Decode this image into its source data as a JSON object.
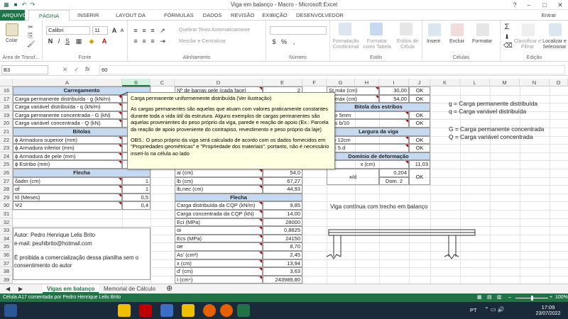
{
  "app": {
    "title": "Viga em balanço - Macro - Microsoft Excel",
    "signin": "Entrar"
  },
  "tabs": [
    "ARQUIVO",
    "PÁGINA INICIAL",
    "INSERIR",
    "LAYOUT DA PÁGINA",
    "FÓRMULAS",
    "DADOS",
    "REVISÃO",
    "EXIBIÇÃO",
    "DESENVOLVEDOR"
  ],
  "ribbon": {
    "paste": "Colar",
    "clipboard": "Área de Transf...",
    "font_name": "Calibri",
    "font_size": "11",
    "font": "Fonte",
    "wrap": "Quebrar Texto Automaticamente",
    "merge": "Mesclar e Centralizar",
    "alignment": "Alinhamento",
    "number": "Número",
    "cond_format": "Formatação Condicional",
    "table_format": "Formatar como Tabela",
    "cell_styles": "Estilos de Célula",
    "styles": "Estilo",
    "insert": "Inserir",
    "delete": "Excluir",
    "format": "Formatar",
    "cells": "Células",
    "sort": "Classificar e Filtrar",
    "find": "Localizar e Selecionar",
    "editing": "Edição"
  },
  "formula": {
    "namebox": "B3",
    "fx": "fx",
    "value": "60"
  },
  "columns": [
    "A",
    "B",
    "C",
    "D",
    "E",
    "F",
    "G",
    "H",
    "I",
    "J",
    "K",
    "L",
    "M",
    "N",
    "O"
  ],
  "rows": [
    "16",
    "17",
    "18",
    "19",
    "20",
    "21",
    "22",
    "23",
    "24",
    "25",
    "26",
    "27",
    "28",
    "29",
    "30",
    "31",
    "32",
    "33",
    "34",
    "35",
    "36",
    "37",
    "38",
    "39",
    "40"
  ],
  "left": {
    "carregamento": "Carregamento",
    "items": [
      "Carga permanente distribuída - g (kN/m)",
      "Carga variável distribuída - q (kN/m)",
      "Carga permanente concentrada - G (kN)",
      "Carga variável concentrada - Q (kN)"
    ],
    "bitolas": "Bitolas",
    "bitola_items": [
      "ϕ Armadura superior (mm)",
      "ϕ Armadura inferior (mm)",
      "ϕ Armadura de pele (mm)",
      "ϕ Estribo (mm)"
    ],
    "flecha": "Flecha",
    "flecha_items": [
      {
        "label": "δadm (cm)",
        "value": "1"
      },
      {
        "label": "αf",
        "value": "1"
      },
      {
        "label": "t0 (Meses)",
        "value": "0,5"
      },
      {
        "label": "Ψ2",
        "value": "0,4"
      }
    ],
    "author": "Autor: Pedro Henrique Lelis Brito",
    "email": "e-mail: peuhlbrito@hotmail.com",
    "notice": "É proibida a comercialização dessa planilha sem o consentimento do autor"
  },
  "middle": {
    "top_rows": [
      {
        "label": "Nº de barras pele (cada face)",
        "value": "2"
      }
    ],
    "rows": [
      {
        "label": "ai (cm)",
        "value": "54,0"
      },
      {
        "label": "lb (cm)",
        "value": "67,27"
      },
      {
        "label": "lb,nec (cm)",
        "value": "44,93"
      }
    ],
    "flecha": "Flecha",
    "flecha_rows": [
      {
        "label": "Carga distribuída da CQP (kN/m)",
        "value": "9,85"
      },
      {
        "label": "Carga concentrada da CQP (kN)",
        "value": "14,00"
      },
      {
        "label": "Eci (MPa)",
        "value": "28000"
      },
      {
        "label": "αi",
        "value": "0,8625"
      },
      {
        "label": "Ecs (MPa)",
        "value": "24150"
      },
      {
        "label": "αe",
        "value": "8,70"
      },
      {
        "label": "As' (cm²)",
        "value": "2,45"
      },
      {
        "label": "x (cm)",
        "value": "13,94"
      },
      {
        "label": "d' (cm)",
        "value": "3,63"
      },
      {
        "label": "I (cm⁴)",
        "value": "243989,80"
      }
    ]
  },
  "right": {
    "smax_rows": [
      {
        "label": "St,máx (cm)",
        "value": "30,00",
        "status": "OK"
      },
      {
        "label": "Sl,máx (cm)",
        "value": "54,00",
        "status": "OK"
      }
    ],
    "bitola_estribos": "Bitola dos estribos",
    "bitola_rows": [
      {
        "label": "ϕt ≥ 5mm",
        "status": "OK"
      },
      {
        "label": "ϕt ≤ b/10",
        "status": "OK"
      }
    ],
    "largura": "Largura da viga",
    "largura_rows": [
      {
        "label": "b ≥ 12cm",
        "status": "OK"
      },
      {
        "label": "b < 5.d",
        "status": "OK"
      }
    ],
    "dominio": "Domínio de deformação",
    "x_row": {
      "label": "x (cm)",
      "value": "11,03"
    },
    "xd": {
      "label": "x/d",
      "value": "0,204",
      "domain": "Dom. 2",
      "status": "OK"
    },
    "legend": [
      "g = Carga permanente distribuída",
      "q = Carga variável distribuída",
      "G = Carga permanente concentrada",
      "Q = Carga variável concentrada"
    ],
    "diagram_label": "Viga contínua com trecho em balanço"
  },
  "comment": {
    "title": "Carga permanente uniformemente distribuída (Ver ilustração)",
    "p1": "As cargas permanentes são aquelas que atuam com valores praticamente constantes durante toda a vida útil da estrutura. Alguns exemplos de cargas permanentes são aquelas provenientes do peso próprio da viga, parede e reação de apoio (Ex.: Parcela da reação de apoio proveniente do contrapiso, revestimento e peso próprio da laje)",
    "p2": "OBS.: O peso próprio da viga será calculado de acordo com os dados fornecidos em \"Propriedades geométricas\" e \"Propriedade dos materiais\", portanto, não é necessário inseri-lo na célula ao lado"
  },
  "sheets": [
    "Vigas em balanço",
    "Memorial de Cálculo"
  ],
  "status": {
    "text": "Célula A17 comentada por Pedro Henrique Lelis Brito",
    "zoom": "100%"
  },
  "taskbar": {
    "lang": "PT",
    "time": "17:09",
    "date": "23/07/2022"
  },
  "colors": {
    "excel_green": "#217346",
    "header_blue": "#c5d9f1",
    "comment_bg": "#ffffe1"
  }
}
